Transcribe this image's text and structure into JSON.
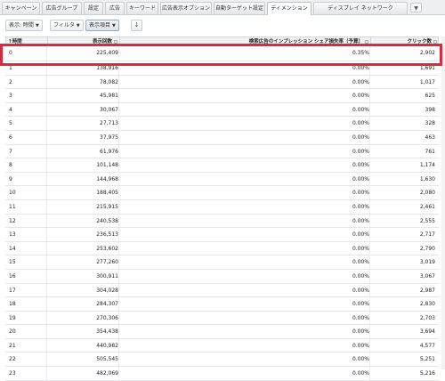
{
  "tabs": [
    {
      "label": "キャンペーン",
      "active": false
    },
    {
      "label": "広告グループ",
      "active": false
    },
    {
      "label": "設定",
      "active": false
    },
    {
      "label": "広告",
      "active": false
    },
    {
      "label": "キーワード",
      "active": false
    },
    {
      "label": "広告表示オプション",
      "active": false
    },
    {
      "label": "自動ターゲット設定",
      "active": false
    },
    {
      "label": "ディメンション",
      "active": true
    },
    {
      "label": "ディスプレイ ネットワーク",
      "active": false
    }
  ],
  "toolbar": {
    "view_label": "表示: 時間",
    "filter_label": "フィルタ",
    "columns_label": "表示項目",
    "caret": "▼",
    "download_icon": "↓"
  },
  "more_tabs_icon": "▼",
  "table": {
    "headers": {
      "hour": "↑時間",
      "impressions": "表示回数",
      "share": "検索広告のインプレッション シェア損失率（予算）",
      "clicks": "クリック数"
    },
    "rows": [
      {
        "hour": "0",
        "impressions": "225,409",
        "share": "0.35%",
        "clicks": "2,902"
      },
      {
        "hour": "1",
        "impressions": "138,916",
        "share": "0.00%",
        "clicks": "1,691"
      },
      {
        "hour": "2",
        "impressions": "78,082",
        "share": "0.00%",
        "clicks": "1,017"
      },
      {
        "hour": "3",
        "impressions": "45,981",
        "share": "0.00%",
        "clicks": "625"
      },
      {
        "hour": "4",
        "impressions": "30,067",
        "share": "0.00%",
        "clicks": "398"
      },
      {
        "hour": "5",
        "impressions": "27,713",
        "share": "0.00%",
        "clicks": "328"
      },
      {
        "hour": "6",
        "impressions": "37,975",
        "share": "0.00%",
        "clicks": "463"
      },
      {
        "hour": "7",
        "impressions": "61,976",
        "share": "0.00%",
        "clicks": "761"
      },
      {
        "hour": "8",
        "impressions": "101,148",
        "share": "0.00%",
        "clicks": "1,174"
      },
      {
        "hour": "9",
        "impressions": "144,968",
        "share": "0.00%",
        "clicks": "1,630"
      },
      {
        "hour": "10",
        "impressions": "188,405",
        "share": "0.00%",
        "clicks": "2,080"
      },
      {
        "hour": "11",
        "impressions": "215,915",
        "share": "0.00%",
        "clicks": "2,461"
      },
      {
        "hour": "12",
        "impressions": "240,538",
        "share": "0.00%",
        "clicks": "2,555"
      },
      {
        "hour": "13",
        "impressions": "236,513",
        "share": "0.00%",
        "clicks": "2,717"
      },
      {
        "hour": "14",
        "impressions": "253,602",
        "share": "0.00%",
        "clicks": "2,790"
      },
      {
        "hour": "15",
        "impressions": "277,260",
        "share": "0.00%",
        "clicks": "3,019"
      },
      {
        "hour": "16",
        "impressions": "300,911",
        "share": "0.00%",
        "clicks": "3,067"
      },
      {
        "hour": "17",
        "impressions": "304,028",
        "share": "0.00%",
        "clicks": "2,987"
      },
      {
        "hour": "18",
        "impressions": "284,307",
        "share": "0.00%",
        "clicks": "2,830"
      },
      {
        "hour": "19",
        "impressions": "270,306",
        "share": "0.00%",
        "clicks": "2,703"
      },
      {
        "hour": "20",
        "impressions": "354,438",
        "share": "0.00%",
        "clicks": "3,694"
      },
      {
        "hour": "21",
        "impressions": "440,982",
        "share": "0.00%",
        "clicks": "4,577"
      },
      {
        "hour": "22",
        "impressions": "505,545",
        "share": "0.00%",
        "clicks": "5,251"
      },
      {
        "hour": "23",
        "impressions": "482,069",
        "share": "0.00%",
        "clicks": "5,216"
      }
    ]
  },
  "colors": {
    "highlight": "#d92a3e",
    "header_bg": "#f1f2f4",
    "tab_active_bg": "#ffffff"
  }
}
